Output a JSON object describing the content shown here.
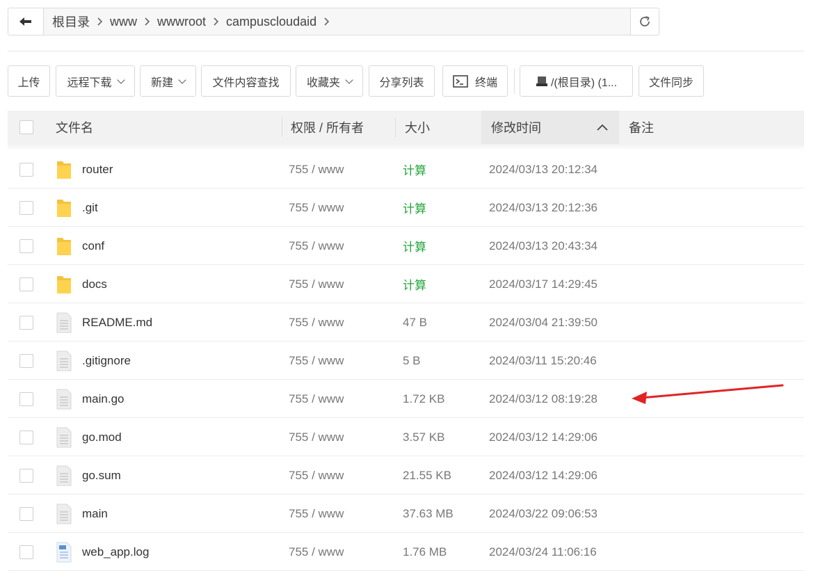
{
  "nav": {
    "breadcrumbs": [
      "根目录",
      "www",
      "wwwroot",
      "campuscloudaid"
    ]
  },
  "toolbar": {
    "upload": "上传",
    "remote_download": "远程下载",
    "new": "新建",
    "content_search": "文件内容查找",
    "favorites": "收藏夹",
    "share_list": "分享列表",
    "terminal": "终端",
    "disk": "/(根目录) (1...",
    "sync": "文件同步"
  },
  "table": {
    "headers": {
      "name": "文件名",
      "perm": "权限 / 所有者",
      "size": "大小",
      "mtime": "修改时间",
      "note": "备注"
    },
    "rows": [
      {
        "name": "router",
        "type": "folder",
        "perm": "755 / www",
        "size": "计算",
        "mtime": "2024/03/13 20:12:34"
      },
      {
        "name": ".git",
        "type": "folder",
        "perm": "755 / www",
        "size": "计算",
        "mtime": "2024/03/13 20:12:36"
      },
      {
        "name": "conf",
        "type": "folder",
        "perm": "755 / www",
        "size": "计算",
        "mtime": "2024/03/13 20:43:34"
      },
      {
        "name": "docs",
        "type": "folder",
        "perm": "755 / www",
        "size": "计算",
        "mtime": "2024/03/17 14:29:45"
      },
      {
        "name": "README.md",
        "type": "file",
        "perm": "755 / www",
        "size": "47 B",
        "mtime": "2024/03/04 21:39:50"
      },
      {
        "name": ".gitignore",
        "type": "file",
        "perm": "755 / www",
        "size": "5 B",
        "mtime": "2024/03/11 15:20:46"
      },
      {
        "name": "main.go",
        "type": "file",
        "perm": "755 / www",
        "size": "1.72 KB",
        "mtime": "2024/03/12 08:19:28"
      },
      {
        "name": "go.mod",
        "type": "file",
        "perm": "755 / www",
        "size": "3.57 KB",
        "mtime": "2024/03/12 14:29:06"
      },
      {
        "name": "go.sum",
        "type": "file",
        "perm": "755 / www",
        "size": "21.55 KB",
        "mtime": "2024/03/12 14:29:06"
      },
      {
        "name": "main",
        "type": "file",
        "perm": "755 / www",
        "size": "37.63 MB",
        "mtime": "2024/03/22 09:06:53"
      },
      {
        "name": "web_app.log",
        "type": "log",
        "perm": "755 / www",
        "size": "1.76 MB",
        "mtime": "2024/03/24 11:06:16"
      }
    ]
  },
  "colors": {
    "calc_green": "#20a53a",
    "annotation_red": "#e02424",
    "folder_yellow": "#f5c23d"
  }
}
